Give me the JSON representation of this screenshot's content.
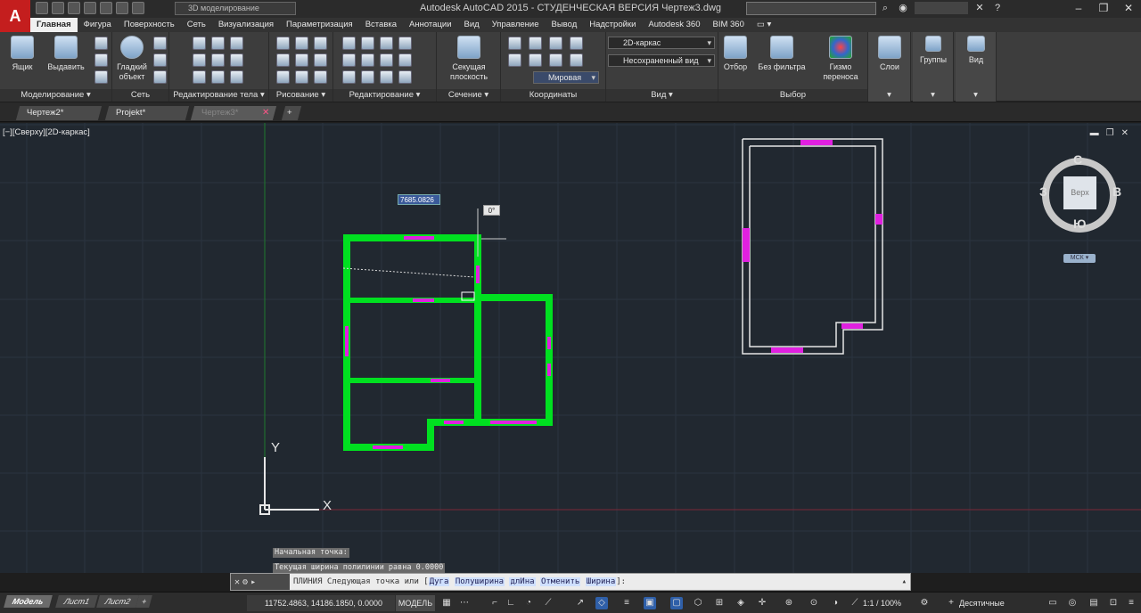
{
  "app": {
    "logo": "A",
    "title": "Autodesk AutoCAD 2015 - СТУДЕНЧЕСКАЯ ВЕРСИЯ    Чертеж3.dwg",
    "workspace": "3D моделирование"
  },
  "ribbon_tabs": [
    "Главная",
    "Фигура",
    "Поверхность",
    "Сеть",
    "Визуализация",
    "Параметризация",
    "Вставка",
    "Аннотации",
    "Вид",
    "Управление",
    "Вывод",
    "Надстройки",
    "Autodesk 360",
    "BIM 360",
    "▭ ▾"
  ],
  "ribbon": {
    "panels": {
      "modeling": "Моделирование ▾",
      "mesh": "Сеть",
      "solid_edit": "Редактирование тела ▾",
      "draw": "Рисование ▾",
      "modify": "Редактирование ▾",
      "section": "Сечение ▾",
      "coords": "Координаты",
      "view": "Вид ▾",
      "selection": "Выбор"
    },
    "buttons": {
      "box": "Ящик",
      "extrude": "Выдавить",
      "smooth": "Гладкий объект",
      "section_plane": "Секущая плоскость",
      "culling": "Отбор",
      "no_filter": "Без фильтра",
      "gizmo": "Гизмо переноса",
      "layers": "Слои",
      "groups": "Группы",
      "view": "Вид"
    },
    "dropdowns": {
      "visual_style": "2D-каркас",
      "saved_view": "Несохраненный вид",
      "coord_system": "Мировая"
    }
  },
  "doc_tabs": [
    {
      "label": "Чертеж2*"
    },
    {
      "label": "Projekt*"
    },
    {
      "label": "Чертеж3*",
      "active": true
    }
  ],
  "viewport": {
    "label": "[−][Сверху][2D-каркас]",
    "length_input": "7685.0826",
    "angle": "0°"
  },
  "viewcube": {
    "north": "С",
    "south": "Ю",
    "west": "З",
    "east": "В",
    "face": "Верх",
    "wcs": "МСК ▾"
  },
  "ucs": {
    "x": "X",
    "y": "Y"
  },
  "command": {
    "history": [
      "Начальная точка:",
      "Текущая ширина полилинии равна 0.0000"
    ],
    "prompt_prefix": "ПЛИНИЯ Следующая точка или [",
    "options": [
      "Дуга",
      "Полуширина",
      "длИна",
      "Отменить",
      "Ширина"
    ],
    "prompt_suffix": "]:"
  },
  "statusbar": {
    "layout_tabs": [
      "Модель",
      "Лист1",
      "Лист2",
      "+"
    ],
    "coords": "11752.4863, 14186.1850, 0.0000",
    "model": "МОДЕЛЬ",
    "scale": "1:1 / 100%",
    "units": "Десятичные"
  },
  "colors": {
    "accent_red": "#c41e1e",
    "wall_green": "#00e020",
    "opening_magenta": "#e020e0",
    "viewport_bg": "#212830"
  }
}
